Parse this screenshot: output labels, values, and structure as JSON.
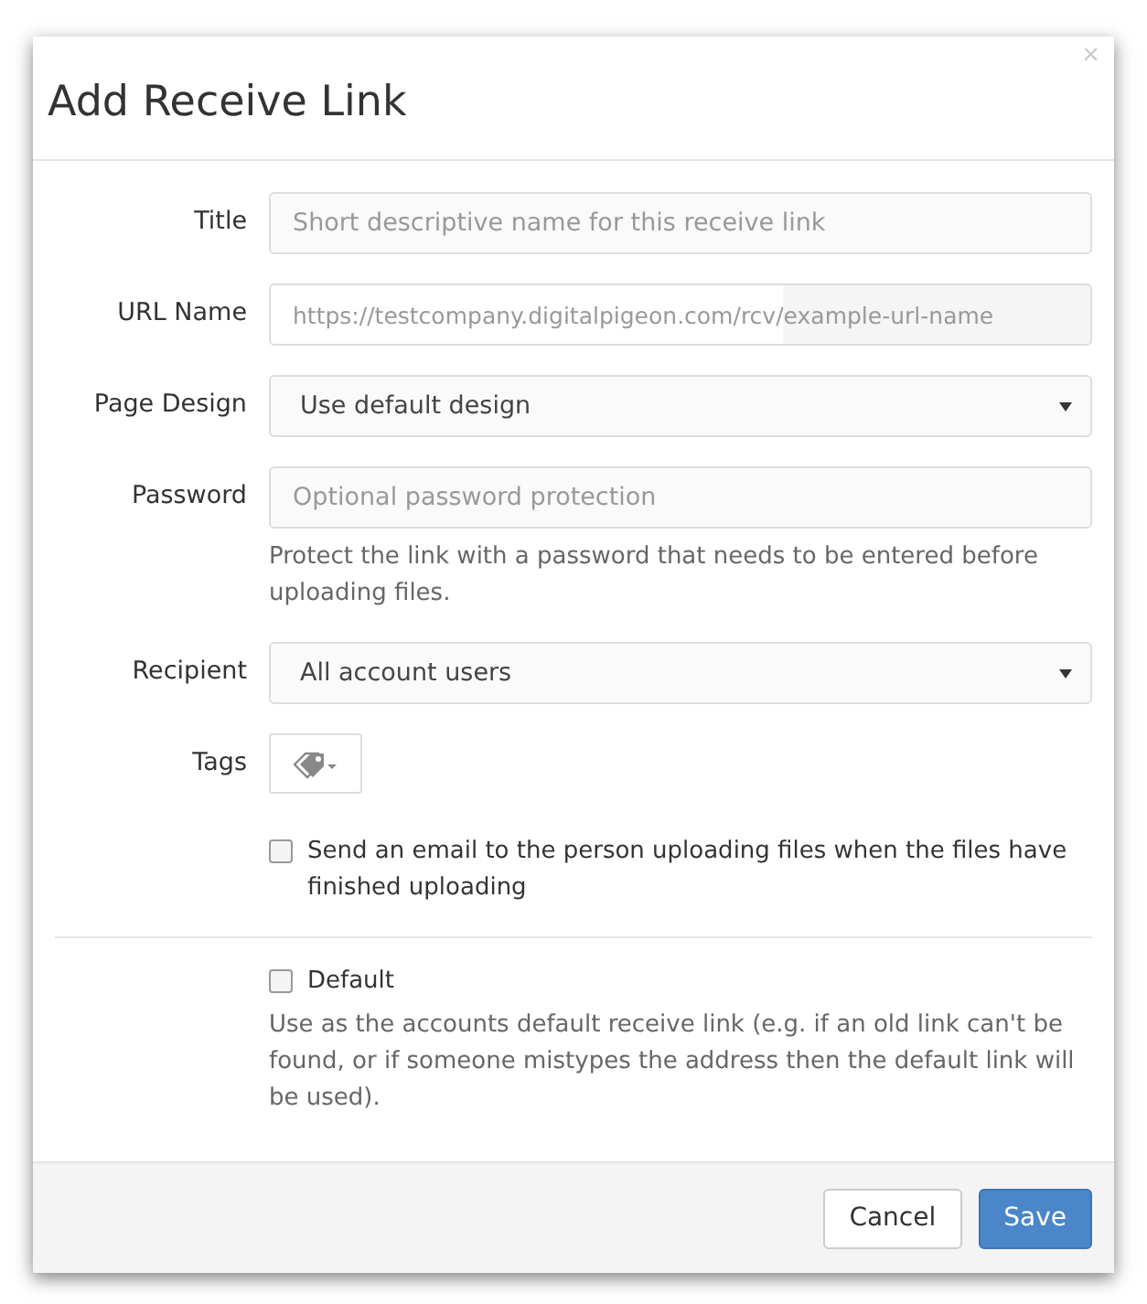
{
  "dialog": {
    "title": "Add Receive Link",
    "close": "×"
  },
  "fields": [
    {
      "kind": "text",
      "label": "Title",
      "placeholder": "Short descriptive name for this receive link"
    },
    {
      "kind": "prefixed",
      "label": "URL Name",
      "prefix": "https://testcompany.digitalpigeon.com/rcv/",
      "placeholder": "example-url-name"
    },
    {
      "kind": "select",
      "label": "Page Design",
      "value": "Use default design"
    },
    {
      "kind": "text",
      "label": "Password",
      "placeholder": "Optional password protection",
      "help": "Protect the link with a password that needs to be entered before uploading files."
    },
    {
      "kind": "select",
      "label": "Recipient",
      "value": "All account users"
    },
    {
      "kind": "tags",
      "label": "Tags"
    }
  ],
  "notify": {
    "label": "Send an email to the person uploading files when the files have finished uploading",
    "checked": false
  },
  "default": {
    "label": "Default",
    "checked": false,
    "help": "Use as the accounts default receive link (e.g. if an old link can't be found, or if someone mistypes the address then the default link will be used)."
  },
  "buttons": [
    {
      "kind": "secondary",
      "label": "Cancel"
    },
    {
      "kind": "primary",
      "label": "Save"
    }
  ]
}
